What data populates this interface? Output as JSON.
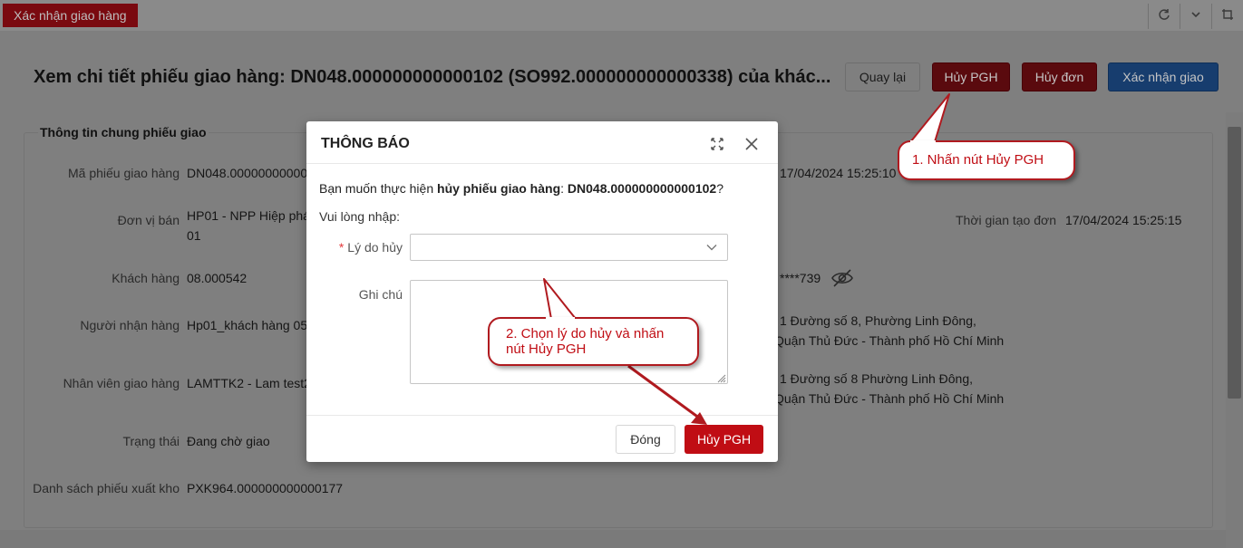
{
  "tab": {
    "label": "Xác nhận giao hàng"
  },
  "tab_icons": [
    "refresh-icon",
    "chevron-down-icon",
    "crop-icon"
  ],
  "header": {
    "title": "Xem chi tiết phiếu giao hàng: DN048.000000000000102 (SO992.000000000000338) của khác...",
    "buttons": {
      "back": "Quay lại",
      "cancel_pgh": "Hủy PGH",
      "cancel_order": "Hủy đơn",
      "confirm": "Xác nhận giao"
    }
  },
  "section": {
    "title": "Thông tin chung phiếu giao",
    "fields": {
      "ma_phieu": {
        "label": "Mã phiếu giao hàng",
        "value": "DN048.000000000000"
      },
      "don_vi_ban": {
        "label": "Đơn vị bán",
        "value_line1": "HP01 - NPP Hiệp phá",
        "value_line2": "01"
      },
      "khach_hang": {
        "label": "Khách hàng",
        "value": "08.000542"
      },
      "nguoi_nhan": {
        "label": "Người nhận hàng",
        "value": "Hp01_khách hàng 05"
      },
      "nhan_vien": {
        "label": "Nhân viên giao hàng",
        "value": "LAMTTK2 - Lam test2"
      },
      "trang_thai": {
        "label": "Trạng thái",
        "value": "Đang chờ giao"
      },
      "danh_sach": {
        "label": "Danh sách phiếu xuất kho",
        "value": "PXK964.000000000000177"
      }
    },
    "right": {
      "date1": "17/04/2024 15:25:10",
      "created_label": "Thời gian tạo đơn",
      "created_value": "17/04/2024 15:25:15",
      "phone": "****739",
      "address1_line1": "1 Đường số 8, Phường Linh Đông,",
      "address1_line2": "Quận Thủ Đức - Thành phố Hồ Chí Minh",
      "address2_line1": "1 Đường số 8 Phường Linh Đông,",
      "address2_line2": "Quận Thủ Đức - Thành phố Hồ Chí Minh"
    }
  },
  "modal": {
    "title": "THÔNG BÁO",
    "message_prefix": "Bạn muốn thực hiện ",
    "message_bold1": "hủy phiếu giao hàng",
    "message_colon": ": ",
    "message_bold2": "DN048.000000000000102",
    "message_suffix": "?",
    "prompt": "Vui lòng nhập:",
    "reason_label": "Lý do hủy",
    "reason_required": "*",
    "reason_value": "",
    "note_label": "Ghi chú",
    "note_value": "",
    "close_button": "Đóng",
    "cancel_button": "Hủy PGH"
  },
  "annotations": {
    "step1": "1. Nhấn nút Hủy PGH",
    "step2": "2. Chọn lý do hủy và nhấn nút Hủy PGH"
  },
  "colors": {
    "brand_red": "#c00d14",
    "callout_border": "#b01a1f",
    "primary_blue": "#1e5aa8"
  }
}
